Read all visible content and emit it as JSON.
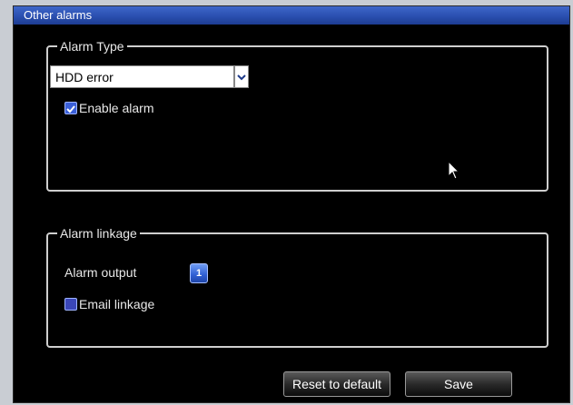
{
  "window": {
    "title": "Other alarms"
  },
  "alarm_type": {
    "legend": "Alarm Type",
    "selected": "HDD error",
    "enable_label": "Enable alarm",
    "enable_checked": true
  },
  "alarm_linkage": {
    "legend": "Alarm linkage",
    "output_label": "Alarm output",
    "output_value": "1",
    "email_label": "Email linkage",
    "email_checked": false
  },
  "buttons": {
    "reset_label": "Reset to default",
    "save_label": "Save"
  },
  "colors": {
    "title_bar": "#2a4fb0",
    "checkbox": "#3a5fd8"
  }
}
